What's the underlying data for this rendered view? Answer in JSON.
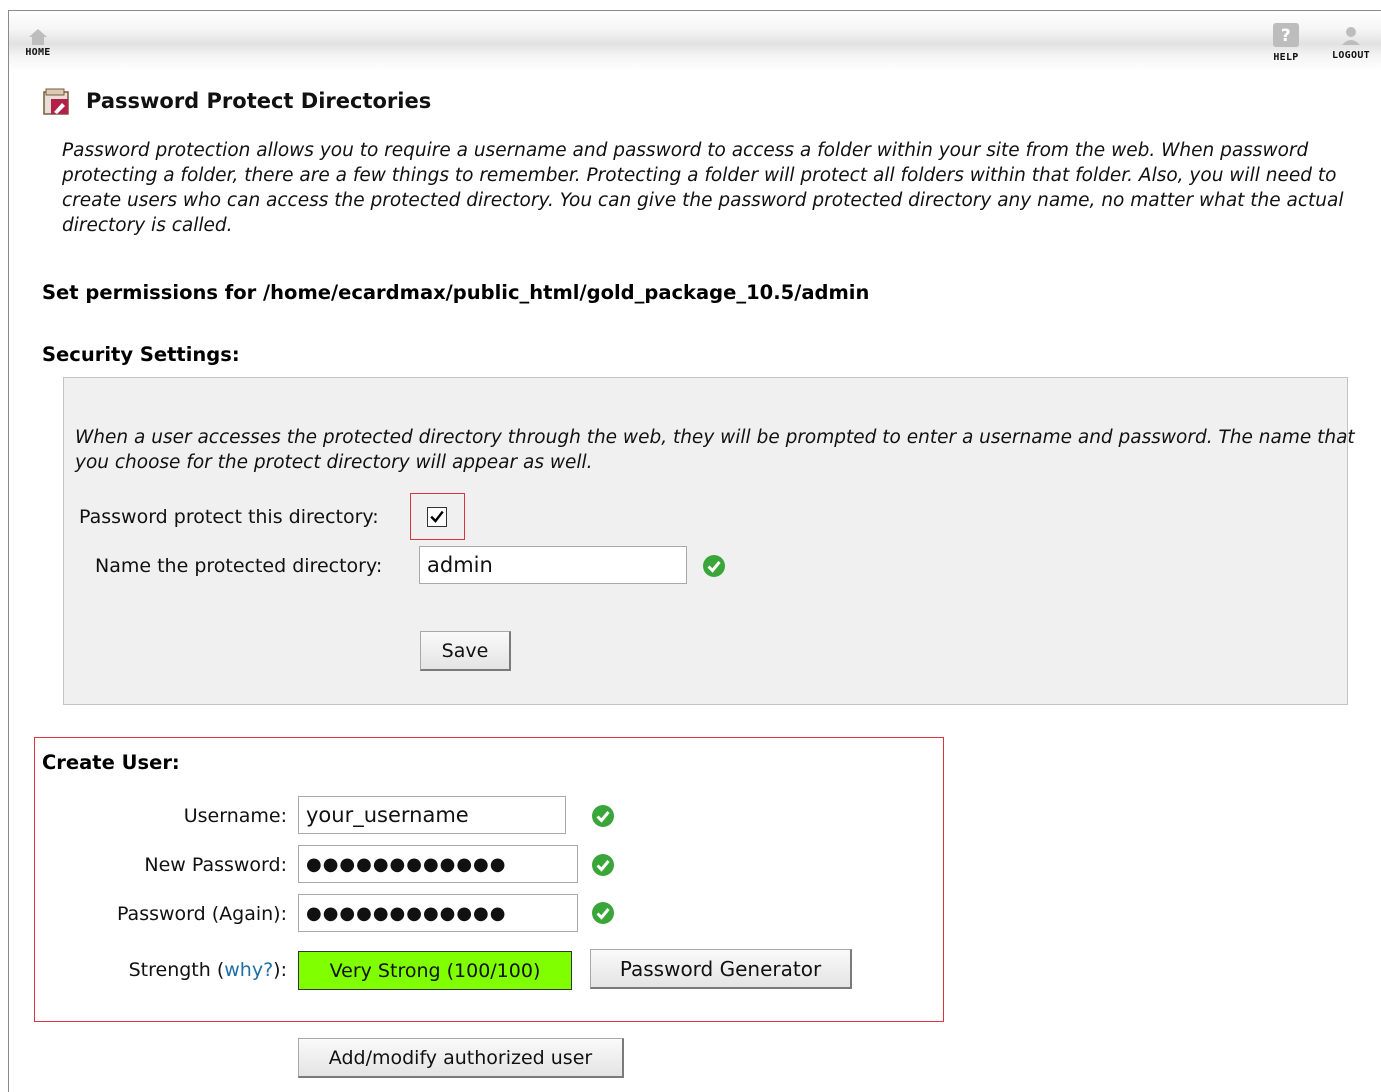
{
  "nav": {
    "home_label": "HOME",
    "help_label": "HELP",
    "logout_label": "LOGOUT"
  },
  "page": {
    "title": "Password Protect Directories",
    "intro": "Password protection allows you to require a username and password to access a folder within your site from the web. When password protecting a folder, there are a few things to remember. Protecting a folder will protect all folders within that folder. Also, you will need to create users who can access the protected directory. You can give the password protected directory any name, no matter what the actual directory is called.",
    "permissions_heading": "Set permissions for /home/ecardmax/public_html/gold_package_10.5/admin"
  },
  "security": {
    "heading": "Security Settings:",
    "description": "When a user accesses the protected directory through the web, they will be prompted to enter a username and password. The name that you choose for the protect directory will appear as well.",
    "protect_label": "Password protect this directory:",
    "protect_checked": true,
    "name_label": "Name the protected directory:",
    "name_value": "admin",
    "save_label": "Save"
  },
  "create_user": {
    "heading": "Create User:",
    "username_label": "Username:",
    "username_value": "your_username",
    "new_password_label": "New Password:",
    "new_password_value": "●●●●●●●●●●●●",
    "password_again_label": "Password (Again):",
    "password_again_value": "●●●●●●●●●●●●",
    "strength_label": "Strength (",
    "strength_link": "why?",
    "strength_label_end": "):",
    "strength_value": "Very Strong (100/100)",
    "strength_color": "#80ff00",
    "generator_label": "Password Generator"
  },
  "actions": {
    "add_user_label": "Add/modify authorized user"
  },
  "colors": {
    "highlight": "#d9343f",
    "ok_green": "#3aa63a",
    "link": "#1e6fa6"
  }
}
